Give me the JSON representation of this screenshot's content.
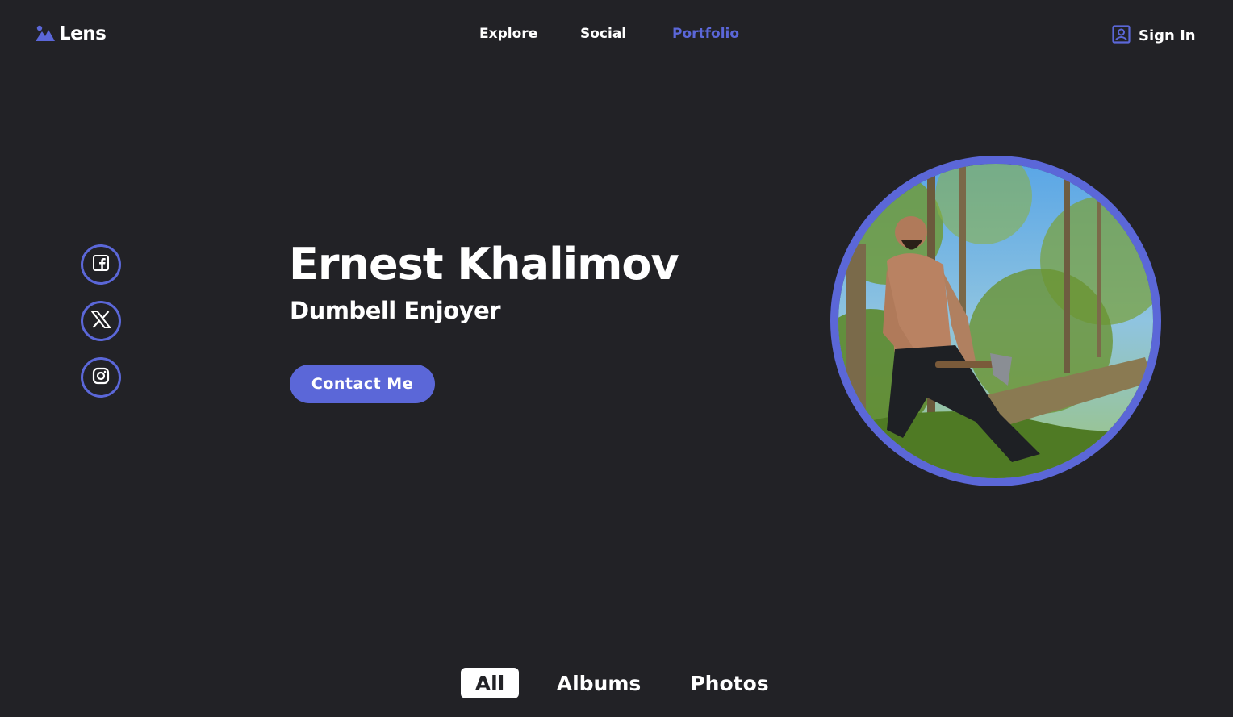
{
  "header": {
    "logo_text": "Lens",
    "nav": [
      {
        "label": "Explore",
        "active": false
      },
      {
        "label": "Social",
        "active": false
      },
      {
        "label": "Portfolio",
        "active": true
      }
    ],
    "signin_label": "Sign In"
  },
  "social_icons": [
    "facebook-icon",
    "x-icon",
    "instagram-icon"
  ],
  "hero": {
    "name": "Ernest Khalimov",
    "subtitle": "Dumbell Enjoyer",
    "contact_label": "Contact Me"
  },
  "tabs": [
    {
      "label": "All",
      "selected": true
    },
    {
      "label": "Albums",
      "selected": false
    },
    {
      "label": "Photos",
      "selected": false
    }
  ],
  "colors": {
    "background": "#222226",
    "accent": "#5b67d8",
    "text": "#ffffff"
  }
}
